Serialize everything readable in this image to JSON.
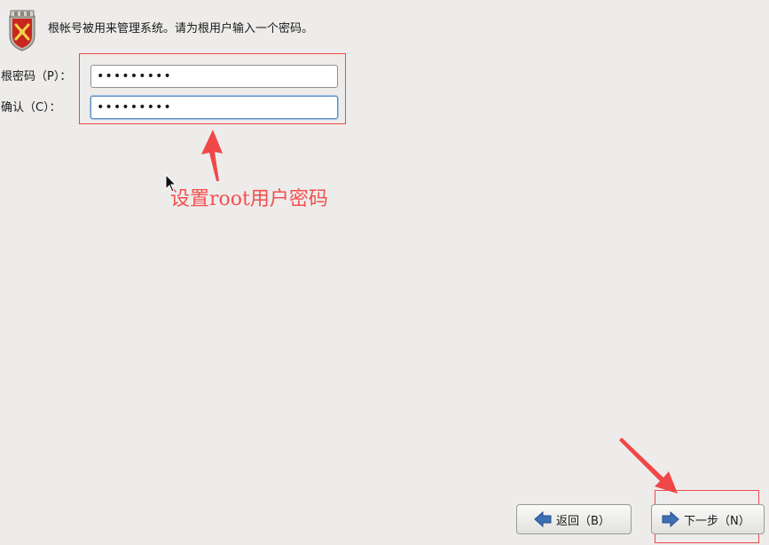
{
  "header": {
    "icon": "shield-icon",
    "text": "根帐号被用来管理系统。请为根用户输入一个密码。"
  },
  "form": {
    "root_password_label": "根密码（P）：",
    "root_password_value": "•••••••••",
    "confirm_label": "确认（C）：",
    "confirm_value": "•••••••••"
  },
  "annotation": {
    "text": "设置root用户密码",
    "color": "#f25050"
  },
  "buttons": {
    "back_label": "返回（B）",
    "back_icon": "arrow-left-icon",
    "next_label": "下一步（N）",
    "next_icon": "arrow-right-icon"
  }
}
